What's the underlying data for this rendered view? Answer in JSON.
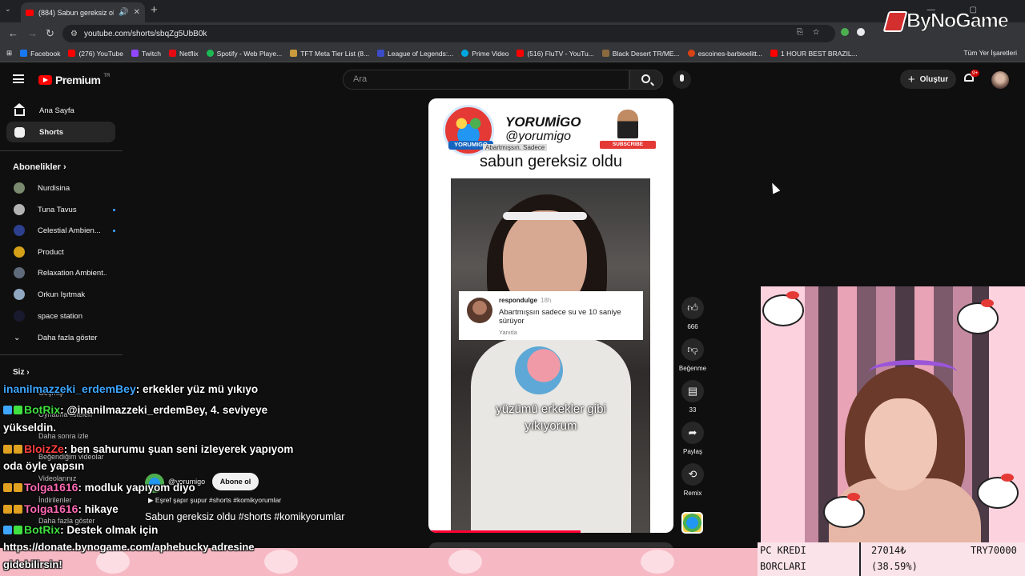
{
  "browser": {
    "tab_title": "(884) Sabun gereksiz oldu",
    "url": "youtube.com/shorts/sbqZg5UbB0k",
    "bookmarks": [
      "Facebook",
      "(276) YouTube",
      "Twitch",
      "Netflix",
      "Spotify - Web Playe...",
      "TFT Meta Tier List (8...",
      "League of Legends:...",
      "Prime Video",
      "(516) FluTV - YouTu...",
      "Black Desert TR/ME...",
      "escoines-barbieelitt...",
      "1 HOUR BEST BRAZIL..."
    ],
    "bookmarks_all": "Tüm Yer İşaretleri"
  },
  "youtube": {
    "logo": "Premium",
    "region": "TR",
    "search_placeholder": "Ara",
    "create_label": "Oluştur",
    "notif_count": "9+"
  },
  "sidebar": {
    "items": [
      {
        "label": "Ana Sayfa"
      },
      {
        "label": "Shorts"
      }
    ],
    "subscriptions_heading": "Abonelikler",
    "subscriptions": [
      {
        "label": "Nurdisina",
        "color": "#7a8a6f"
      },
      {
        "label": "Tuna Tavus",
        "color": "#b3b3b3"
      },
      {
        "label": "Celestial Ambien...",
        "color": "#2d3f8f"
      },
      {
        "label": "Product",
        "color": "#d4a017"
      },
      {
        "label": "Relaxation Ambient...",
        "color": "#5f6b7a"
      },
      {
        "label": "Orkun Işıtmak",
        "color": "#8fa7c0"
      },
      {
        "label": "space station",
        "color": "#1a1a2e"
      }
    ],
    "show_more": "Daha fazla göster",
    "you_heading": "Siz",
    "you_items": [
      "Geçmiş",
      "Oynatma listeleri",
      "Daha sonra izle",
      "Beğendiğim videolar",
      "Videolarınız",
      "İndirilenler",
      "Daha fazla göster"
    ]
  },
  "short": {
    "channel_name": "YORUMİGO",
    "channel_handle": "@yorumigo",
    "logo_tag": "YORUMIGO",
    "hint": "Abartmışsın. Sadece",
    "subscribe_badge": "SUBSCRIBE",
    "headline": "sabun gereksiz oldu",
    "comment_user": "respondulge",
    "comment_time": "18h",
    "comment_text": "Abartmışsın sadece su ve 10 saniye sürüyor",
    "comment_reply": "Yanıtla",
    "caption_line1": "yüzümü erkekler gibi",
    "caption_line2": "yıkıyorum",
    "progress_fraction": 0.62,
    "meta_handle": "@yorumigo",
    "subscribe_label": "Abone ol",
    "music": "Eşref şapır şupur #shorts #komikyorumlar",
    "title": "Sabun gereksiz oldu  #shorts #komikyorumlar"
  },
  "actions": {
    "like_count": "666",
    "dislike_label": "Beğenme",
    "comment_count": "33",
    "share_label": "Paylaş",
    "remix_label": "Remix"
  },
  "stream": {
    "watermark": "ByNoGame",
    "chat": [
      {
        "user": "inanilmazzeki_erdemBey",
        "color": "#3ea6ff",
        "msg": ": erkekler yüz mü yıkıyo"
      },
      {
        "user": "BotRix",
        "color": "#40e040",
        "msg": ": @inanilmazzeki_erdemBey, 4. seviyeye"
      },
      {
        "user": "",
        "color": "#ffffff",
        "msg": "yükseldin."
      },
      {
        "user": "BloizZe",
        "color": "#ff4040",
        "msg": ": ben sahurumu şuan seni izleyerek yapıyom"
      },
      {
        "user": "",
        "color": "#ffffff",
        "msg": "oda öyle yapsın"
      },
      {
        "user": "Tolga1616",
        "color": "#ff69b4",
        "msg": ": modluk yapıyom diyo"
      },
      {
        "user": "Tolga1616",
        "color": "#ff69b4",
        "msg": ": hikaye"
      },
      {
        "user": "BotRix",
        "color": "#40e040",
        "msg": ": Destek olmak için"
      }
    ],
    "donate_line1": "https://donate.bynogame.com/aphebucky adresine",
    "donate_line2": "gidebilirsin!",
    "stats_label1": "PC KREDI",
    "stats_label2": "BORCLARI",
    "stats_value1": "27014₺",
    "stats_value2": "(38.59%)",
    "stats_code": "TRY70000"
  }
}
